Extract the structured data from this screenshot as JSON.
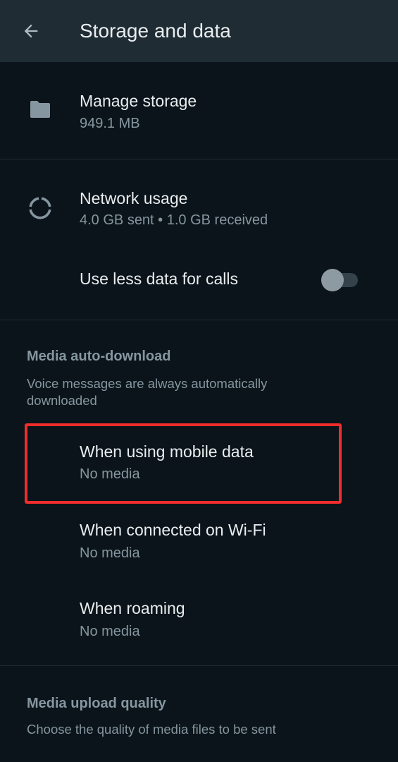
{
  "header": {
    "title": "Storage and data",
    "back_icon": "arrow-left-icon"
  },
  "storage": {
    "manage_title": "Manage storage",
    "manage_sub": "949.1 MB",
    "manage_icon": "folder-icon",
    "network_title": "Network usage",
    "network_sub": "4.0 GB sent • 1.0 GB received",
    "network_icon": "data-usage-icon",
    "less_data_title": "Use less data for calls",
    "less_data_on": false
  },
  "media_auto_download": {
    "header": "Media auto-download",
    "description": "Voice messages are always automatically downloaded",
    "items": [
      {
        "title": "When using mobile data",
        "sub": "No media"
      },
      {
        "title": "When connected on Wi-Fi",
        "sub": "No media"
      },
      {
        "title": "When roaming",
        "sub": "No media"
      }
    ]
  },
  "media_upload_quality": {
    "header": "Media upload quality",
    "description": "Choose the quality of media files to be sent"
  },
  "colors": {
    "background": "#0b141a",
    "appbar": "#1f2c34",
    "primary_text": "#e9edef",
    "secondary_text": "#8696a0",
    "highlight": "#ef2d2d"
  }
}
